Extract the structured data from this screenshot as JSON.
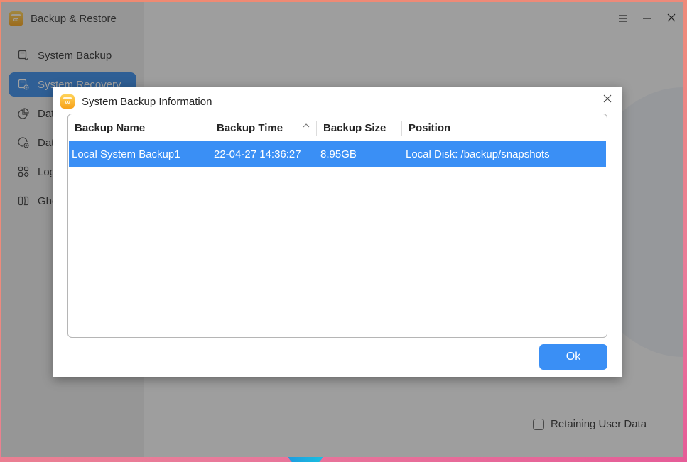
{
  "app": {
    "title": "Backup & Restore"
  },
  "window_controls": {
    "menu_icon": "hamburger-menu-icon",
    "minimize_icon": "minimize-icon",
    "close_icon": "close-icon"
  },
  "sidebar": {
    "items": [
      {
        "label": "System Backup",
        "icon": "system-backup-icon",
        "active": false
      },
      {
        "label": "System Recovery",
        "icon": "system-recovery-icon",
        "active": true
      },
      {
        "label": "Data Backup",
        "icon": "data-backup-icon",
        "active": false
      },
      {
        "label": "Data Recovery",
        "icon": "data-recovery-icon",
        "active": false
      },
      {
        "label": "Log",
        "icon": "log-icon",
        "active": false
      },
      {
        "label": "Ghost",
        "icon": "ghost-icon",
        "active": false
      }
    ]
  },
  "main": {
    "retain_user_data_label": "Retaining User Data",
    "retain_user_data_checked": false
  },
  "dialog": {
    "title": "System Backup Information",
    "table": {
      "columns": [
        {
          "label": "Backup Name"
        },
        {
          "label": "Backup Time",
          "sort": "ascending"
        },
        {
          "label": "Backup Size"
        },
        {
          "label": "Position"
        }
      ],
      "rows": [
        {
          "name": "Local System Backup1",
          "time": "22-04-27 14:36:27",
          "size": "8.95GB",
          "position": "Local Disk: /backup/snapshots",
          "selected": true
        }
      ]
    },
    "ok_label": "Ok"
  },
  "colors": {
    "accent": "#3a8ff5",
    "sidebar_active": "#3b8dea"
  }
}
